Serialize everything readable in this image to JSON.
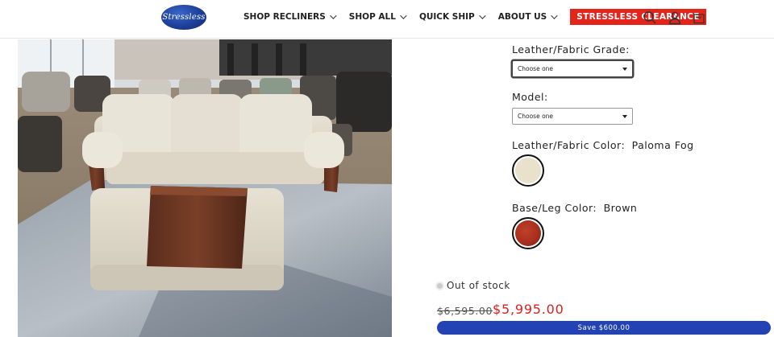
{
  "header": {
    "logo_text": "Stressless",
    "nav": [
      {
        "label": "SHOP RECLINERS"
      },
      {
        "label": "SHOP ALL"
      },
      {
        "label": "QUICK SHIP"
      },
      {
        "label": "ABOUT US"
      }
    ],
    "clearance_label": "STRESSLESS CLEARANCE",
    "icons": [
      "search-icon",
      "account-icon",
      "cart-icon"
    ]
  },
  "product_image": {
    "alt": "Stressless sofa with ottoman in showroom"
  },
  "options": {
    "grade": {
      "label": "Leather/Fabric Grade:",
      "value": "Choose one"
    },
    "model": {
      "label": "Model:",
      "value": "Choose one"
    },
    "color": {
      "label": "Leather/Fabric Color:",
      "value": "Paloma Fog",
      "swatch": "#e9e1cc"
    },
    "base": {
      "label": "Base/Leg Color:",
      "value": "Brown",
      "swatch": "#a8301e"
    }
  },
  "stock": {
    "status": "Out of stock"
  },
  "price": {
    "regular": "$6,595.00",
    "sale": "$5,995.00",
    "savings": "Save $600.00"
  },
  "colors": {
    "sale_red": "#d72020",
    "clearance_red": "#e3241b",
    "save_blue": "#2342b3"
  }
}
